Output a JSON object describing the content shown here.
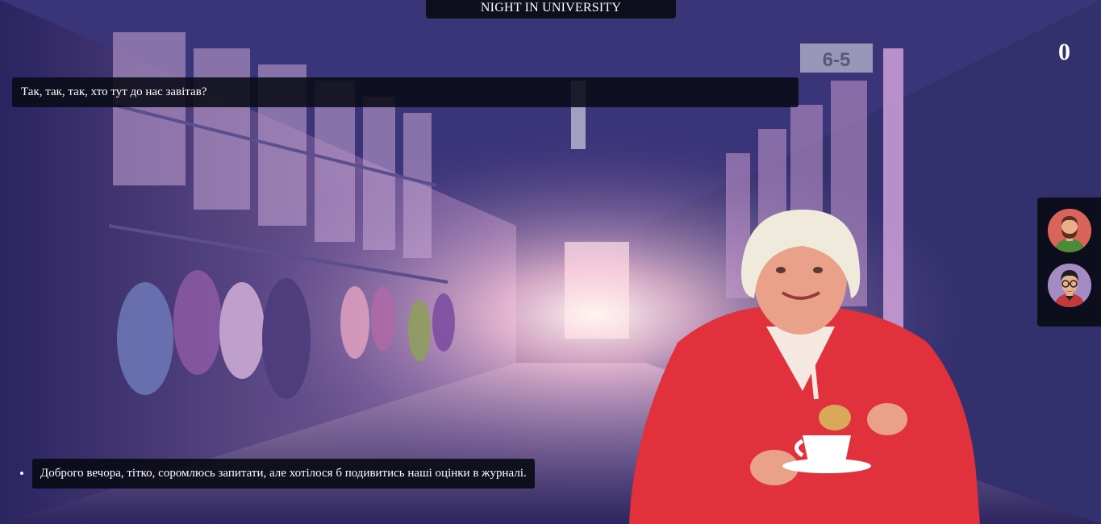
{
  "game": {
    "title": "NIGHT IN UNIVERSITY",
    "score": "0"
  },
  "dialog": {
    "npc_line": "Так, так, так, хто тут до нас завітав?"
  },
  "choices": [
    {
      "label": "Доброго вечора, тітко, соромлюсь запитати, але хотілося б подивитись наші оцінки в журналі."
    }
  ],
  "scene": {
    "room_sign": "6-5"
  },
  "characters": [
    {
      "icon": "bearded-man-avatar-icon",
      "bg": "#d8645a"
    },
    {
      "icon": "glasses-man-avatar-icon",
      "bg": "#a58bc4"
    }
  ],
  "colors": {
    "panel_bg": "#0a0c16",
    "text": "#ffffff",
    "npc_sweater": "#e0313d"
  }
}
